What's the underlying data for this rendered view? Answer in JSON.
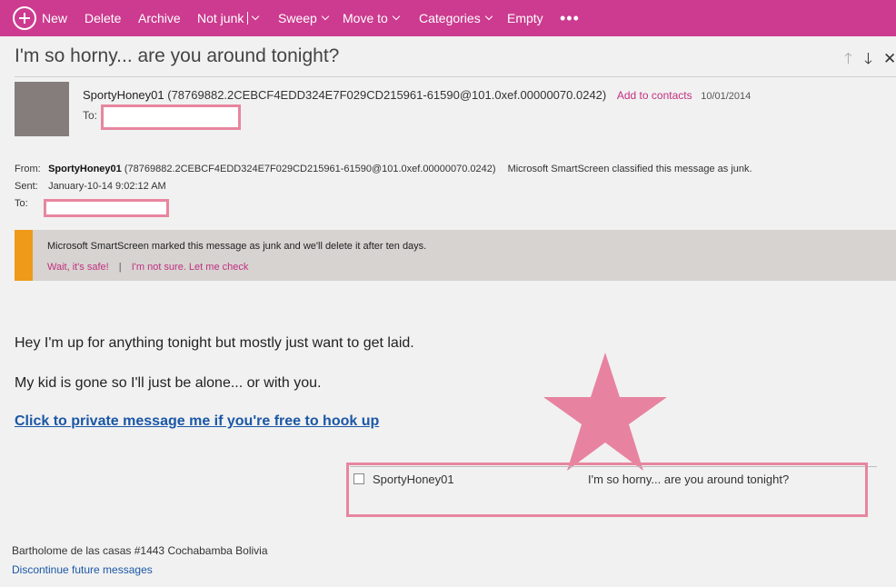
{
  "toolbar": {
    "new_label": "New",
    "delete_label": "Delete",
    "archive_label": "Archive",
    "not_junk_label": "Not junk",
    "sweep_label": "Sweep",
    "move_to_label": "Move to",
    "categories_label": "Categories",
    "empty_label": "Empty",
    "more_label": "•••",
    "accent_color": "#cc3b8f"
  },
  "message": {
    "subject": "I'm so horny... are you around tonight?",
    "nav": {
      "up": "🡑",
      "down": "🡓",
      "close": "✕"
    },
    "header": {
      "sender_name": "SportyHoney01",
      "sender_address": "(78769882.2CEBCF4EDD324E7F029CD215961-61590@101.0xef.00000070.0242)",
      "add_to_contacts": "Add to contacts",
      "date": "10/01/2014",
      "to_label": "To:"
    },
    "details": {
      "from_label": "From:",
      "from_name": "SportyHoney01",
      "from_address": "(78769882.2CEBCF4EDD324E7F029CD215961-61590@101.0xef.00000070.0242)",
      "junk_note": "Microsoft SmartScreen classified this message as junk.",
      "sent_label": "Sent:",
      "sent_value": "January-10-14 9:02:12 AM",
      "to_label": "To:"
    },
    "banner": {
      "text": "Microsoft SmartScreen marked this message as junk and we'll delete it after ten days.",
      "safe_link": "Wait, it's safe!",
      "separator": "|",
      "check_link": "I'm not sure. Let me check",
      "stripe_color": "#ef9a18"
    },
    "body": {
      "line1": "Hey I'm up for anything tonight but mostly just want to get laid.",
      "line2": "My kid is gone so I'll just be alone... or with you.",
      "link": "Click to private message me if you're free to hook up"
    },
    "preview": {
      "sender": "SportyHoney01",
      "subject": "I'm so horny... are you around tonight?"
    },
    "footer": {
      "address": "Bartholome de las casas #1443 Cochabamba Bolivia",
      "unsubscribe": "Discontinue future messages"
    }
  }
}
